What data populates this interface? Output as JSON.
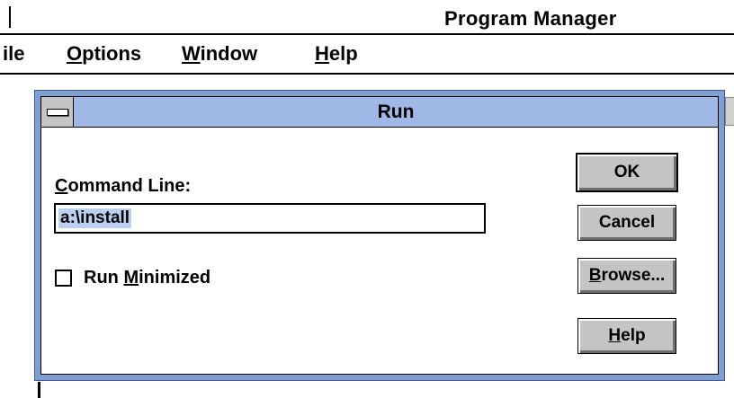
{
  "app": {
    "title": "Program Manager"
  },
  "menu": {
    "file_rest": "ile",
    "options_first": "O",
    "options_rest": "ptions",
    "window_first": "W",
    "window_rest": "indow",
    "help_first": "H",
    "help_rest": "elp"
  },
  "dialog": {
    "title": "Run",
    "command_label_first": "C",
    "command_label_rest": "ommand Line:",
    "command_value": "a:\\install",
    "run_minimized_checked": false,
    "run_minimized_prefix": "Run ",
    "run_minimized_first": "M",
    "run_minimized_rest": "inimized",
    "ok_label": "OK",
    "cancel_label": "Cancel",
    "browse_first": "B",
    "browse_rest": "rowse...",
    "help_first": "H",
    "help_rest": "elp"
  },
  "colors": {
    "title_bar": "#9fb8e6",
    "dialog_frame": "#7f9fd0",
    "button_face": "#c4c4c4",
    "selection": "#bcd0f2"
  },
  "icons": {
    "system_menu": "system-menu-bar-icon"
  }
}
